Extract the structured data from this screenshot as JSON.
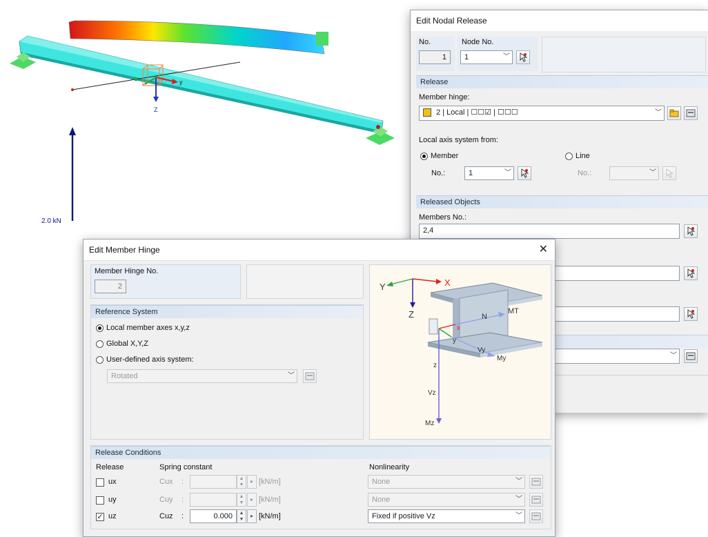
{
  "viewport": {
    "axis_label_z": "Z",
    "axis_label_y": "y",
    "load_label": "2.0 kN",
    "colors": {
      "beam": "#3fe6e0",
      "support": "#4cd964",
      "load": "#0b1a7a"
    }
  },
  "nodal_release": {
    "title": "Edit Nodal Release",
    "no_label": "No.",
    "no_value": "1",
    "node_no_label": "Node No.",
    "node_no_value": "1",
    "release_section": "Release",
    "member_hinge_label": "Member hinge:",
    "member_hinge_value": "2 | Local | ☐☐☑ | ☐☐☐",
    "member_hinge_color": "#f2c012",
    "local_axis_label": "Local axis system from:",
    "radio_member": "Member",
    "radio_line": "Line",
    "member_no_label": "No.:",
    "member_no_value": "1",
    "line_no_label": "No.:",
    "released_objects_section": "Released Objects",
    "members_no_label": "Members No.:",
    "members_no_value": "2,4"
  },
  "member_hinge": {
    "title": "Edit Member Hinge",
    "close_glyph": "✕",
    "hinge_no_label": "Member Hinge No.",
    "hinge_no_value": "2",
    "reference_section": "Reference System",
    "ref_local": "Local member axes x,y,z",
    "ref_global": "Global X,Y,Z",
    "ref_user": "User-defined axis system:",
    "ref_user_value": "Rotated",
    "release_conditions_section": "Release Conditions",
    "col_release": "Release",
    "col_spring": "Spring constant",
    "col_nonlinearity": "Nonlinearity",
    "rows": [
      {
        "release": "ux",
        "checked": false,
        "const": "Cux",
        "value": "",
        "unit": "[kN/m]",
        "nonlin": "None",
        "enabled": false
      },
      {
        "release": "uy",
        "checked": false,
        "const": "Cuy",
        "value": "",
        "unit": "[kN/m]",
        "nonlin": "None",
        "enabled": false
      },
      {
        "release": "uz",
        "checked": true,
        "const": "Cuz",
        "value": "0.000",
        "unit": "[kN/m]",
        "nonlin": "Fixed if positive Vz",
        "enabled": true
      }
    ],
    "diagram": {
      "Y": "Y",
      "X": "X",
      "Z": "Z",
      "N": "N",
      "MT": "MT",
      "x": "x",
      "y": "y",
      "z": "z",
      "Vy": "Vy",
      "My": "My",
      "Vz": "Vz",
      "Mz": "Mz"
    }
  }
}
